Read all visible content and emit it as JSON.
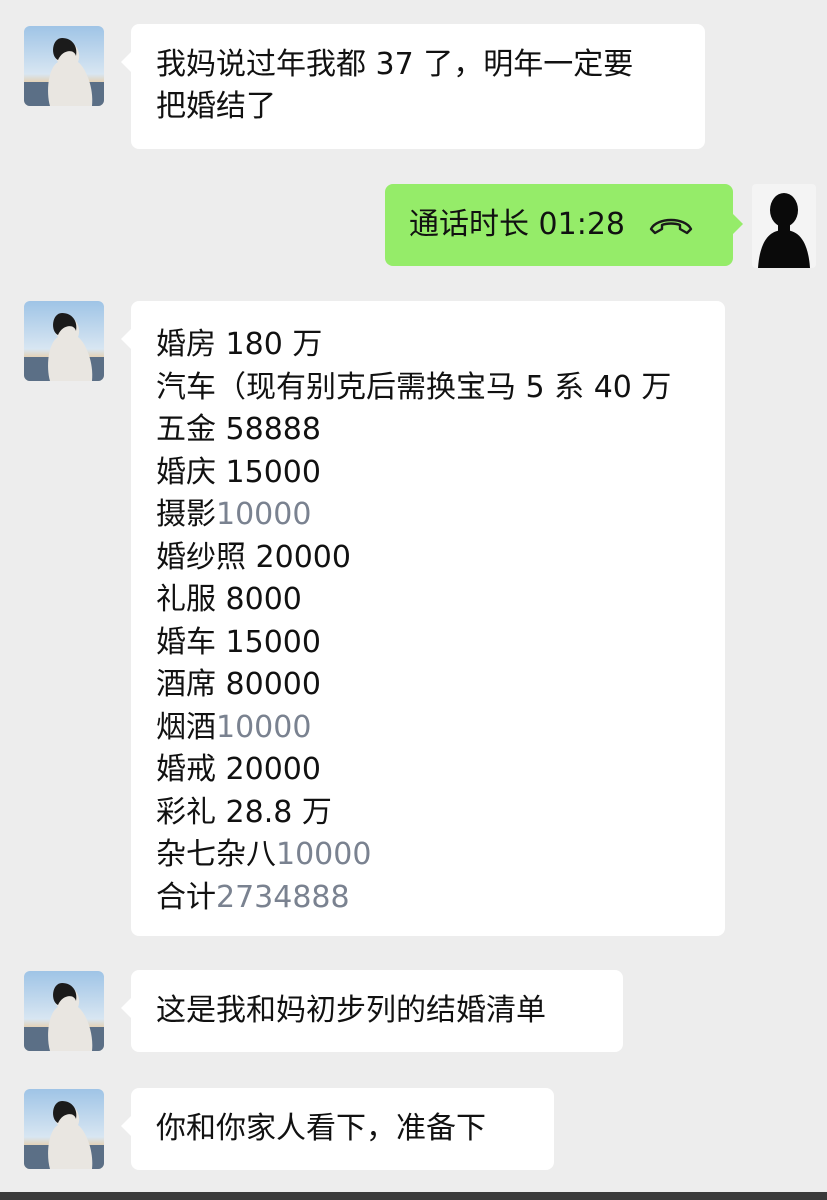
{
  "messages": [
    {
      "side": "left",
      "lines": [
        "我妈说过年我都 37 了，明年一定要",
        "把婚结了"
      ]
    },
    {
      "side": "right",
      "call_text": "通话时长 01:28",
      "icon": "phone-hangup-icon"
    },
    {
      "side": "left",
      "list": [
        {
          "label": "婚房 180 万",
          "value": ""
        },
        {
          "label": "汽车（现有别克后需换宝马 5 系 40 万",
          "value": ""
        },
        {
          "label": "五金 58888",
          "value": ""
        },
        {
          "label": "婚庆 15000",
          "value": ""
        },
        {
          "label": "摄影",
          "value": "10000"
        },
        {
          "label": "婚纱照 20000",
          "value": ""
        },
        {
          "label": "礼服 8000",
          "value": ""
        },
        {
          "label": "婚车 15000",
          "value": ""
        },
        {
          "label": "酒席 80000",
          "value": ""
        },
        {
          "label": "烟酒",
          "value": "10000"
        },
        {
          "label": "婚戒 20000",
          "value": ""
        },
        {
          "label": "彩礼 28.8 万",
          "value": ""
        },
        {
          "label": "杂七杂八",
          "value": "10000"
        },
        {
          "label": "合计",
          "value": "2734888"
        }
      ]
    },
    {
      "side": "left",
      "lines": [
        "这是我和妈初步列的结婚清单"
      ]
    },
    {
      "side": "left",
      "lines": [
        "你和你家人看下，准备下"
      ]
    }
  ],
  "colors": {
    "background": "#ededed",
    "bubble_incoming": "#ffffff",
    "bubble_outgoing": "#95ec69",
    "grey_number": "#7a8290"
  }
}
